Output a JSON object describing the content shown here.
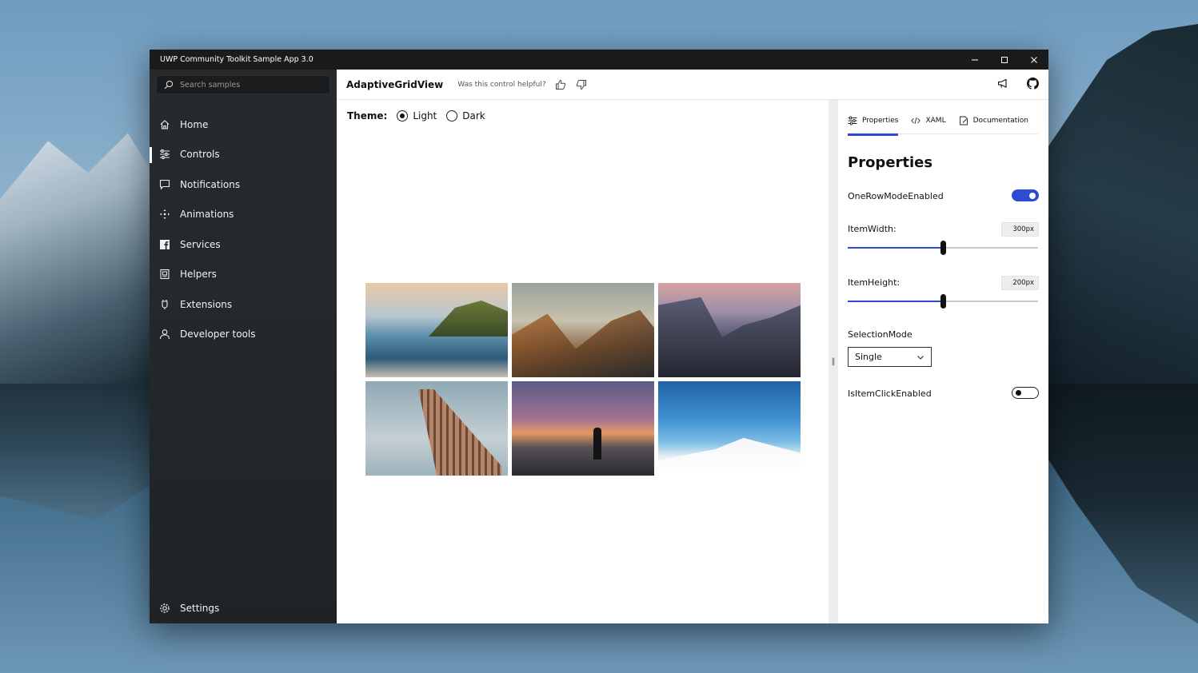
{
  "window": {
    "title": "UWP Community Toolkit Sample App 3.0",
    "controls": [
      "minimize-icon",
      "maximize-icon",
      "close-icon"
    ]
  },
  "sidebar": {
    "search_placeholder": "Search samples",
    "items": [
      {
        "label": "Home",
        "icon": "home-icon"
      },
      {
        "label": "Controls",
        "icon": "sliders-icon",
        "active": true
      },
      {
        "label": "Notifications",
        "icon": "message-icon"
      },
      {
        "label": "Animations",
        "icon": "animation-icon"
      },
      {
        "label": "Services",
        "icon": "facebook-icon"
      },
      {
        "label": "Helpers",
        "icon": "helpers-icon"
      },
      {
        "label": "Extensions",
        "icon": "extension-icon"
      },
      {
        "label": "Developer tools",
        "icon": "developer-icon"
      }
    ],
    "settings_label": "Settings"
  },
  "header": {
    "control_name": "AdaptiveGridView",
    "helpful_text": "Was this control helpful?",
    "icons": [
      "thumbs-up-icon",
      "thumbs-down-icon",
      "megaphone-icon",
      "github-icon"
    ]
  },
  "sample": {
    "theme_label": "Theme:",
    "theme_options": [
      {
        "label": "Light",
        "selected": true
      },
      {
        "label": "Dark",
        "selected": false
      }
    ],
    "images": [
      "lake-photo",
      "mountain-photo",
      "valley-photo",
      "building-photo",
      "sunset-photo",
      "sky-photo"
    ]
  },
  "panel": {
    "tabs": [
      {
        "label": "Properties",
        "icon": "properties-icon",
        "active": true
      },
      {
        "label": "XAML",
        "icon": "code-icon"
      },
      {
        "label": "Documentation",
        "icon": "document-icon"
      }
    ],
    "heading": "Properties",
    "one_row_mode": {
      "label": "OneRowModeEnabled",
      "value": true
    },
    "item_width": {
      "label": "ItemWidth:",
      "value": "300px",
      "fraction": 0.5
    },
    "item_height": {
      "label": "ItemHeight:",
      "value": "200px",
      "fraction": 0.5
    },
    "selection_mode": {
      "label": "SelectionMode",
      "value": "Single"
    },
    "is_item_click": {
      "label": "IsItemClickEnabled",
      "value": false
    }
  },
  "colors": {
    "accent": "#2d4bd6",
    "sidebar_bg": "#23292c",
    "titlebar_bg": "#1b1b1b"
  }
}
